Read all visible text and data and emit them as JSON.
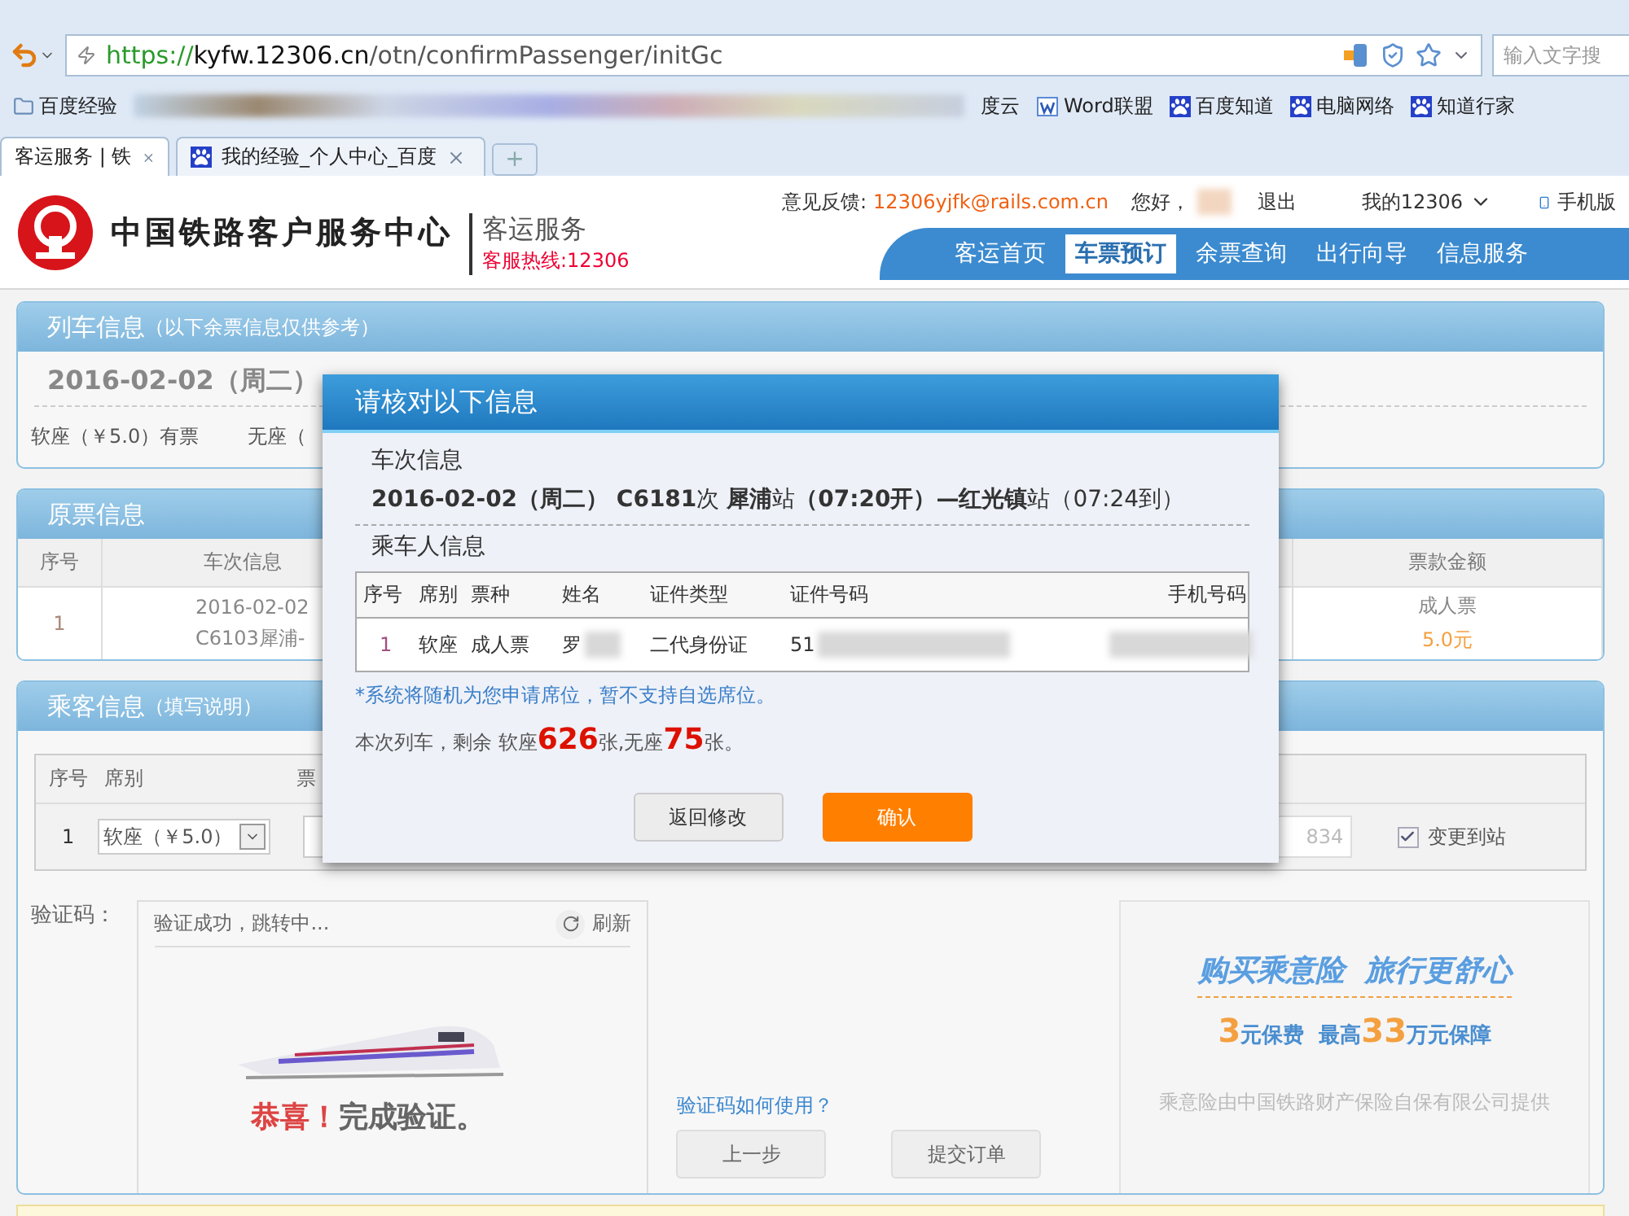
{
  "browser": {
    "address": {
      "scheme": "https://",
      "host": "kyfw.12306.cn",
      "path": "/otn/confirmPassenger/initGc"
    },
    "search": {
      "placeholder": "输入文字搜"
    },
    "bookmarks": [
      {
        "label": "百度经验",
        "kind": "folder"
      },
      {
        "label": "度云",
        "kind": "plain"
      },
      {
        "label": "Word联盟",
        "kind": "doc"
      },
      {
        "label": "百度知道",
        "kind": "paw"
      },
      {
        "label": "电脑网络",
        "kind": "paw"
      },
      {
        "label": "知道行家",
        "kind": "paw"
      }
    ],
    "tabs": [
      {
        "label": "客运服务 | 铁",
        "selected": true,
        "icon": false
      },
      {
        "label": "我的经验_个人中心_百度",
        "selected": false,
        "icon": true
      }
    ],
    "new_tab": "+"
  },
  "header": {
    "site_title": "中国铁路客户服务中心",
    "section": "客运服务",
    "hotline": "客服热线:12306",
    "feedback_label": "意见反馈:",
    "feedback_email": "12306yjfk@rails.com.cn",
    "greeting": "您好，",
    "logout": "退出",
    "account": "我的12306",
    "mobile": "手机版",
    "nav": [
      {
        "label": "客运首页",
        "selected": false
      },
      {
        "label": "车票预订",
        "selected": true
      },
      {
        "label": "余票查询",
        "selected": false
      },
      {
        "label": "出行向导",
        "selected": false
      },
      {
        "label": "信息服务",
        "selected": false
      }
    ]
  },
  "train_info": {
    "title": "列车信息",
    "note": "（以下余票信息仅供参考）",
    "date": "2016-02-02（周二）",
    "seats": [
      "软座（￥5.0）有票",
      "无座（"
    ]
  },
  "original_ticket": {
    "title": "原票信息",
    "columns": [
      "序号",
      "车次信息",
      "票款金额"
    ],
    "row": {
      "index": "1",
      "train_line_1": "2016-02-02",
      "train_line_2": "C6103犀浦-",
      "ticket_type": "成人票",
      "price": "5.0元"
    }
  },
  "passenger_info": {
    "title": "乘客信息",
    "note": "（填写说明）",
    "columns": [
      "序号",
      "席别",
      "票"
    ],
    "row": {
      "index": "1",
      "seat": "软座（￥5.0）",
      "phone_fragment": "834",
      "change_station": {
        "label": "变更到站",
        "checked": true
      }
    }
  },
  "captcha": {
    "label": "验证码：",
    "status": "验证成功，跳转中...",
    "refresh": "刷新",
    "congrats": "恭喜！",
    "done": "完成验证。",
    "help_link": "验证码如何使用？",
    "buttons": [
      "上一步",
      "提交订单"
    ]
  },
  "insurance": {
    "headline": "购买乘意险  旅行更舒心",
    "offer": "**3**元保费  最高**33**万元保障",
    "provider": "乘意险由中国铁路财产保险自保有限公司提供"
  },
  "dialog": {
    "title": "请核对以下信息",
    "train_heading": "车次信息",
    "train_line": "**2016-02-02（周二）  C6181**次 **犀浦**站**（07:20开）—红光镇**站（07:24到）",
    "passenger_heading": "乘车人信息",
    "columns": [
      "序号",
      "席别",
      "票种",
      "姓名",
      "证件类型",
      "证件号码",
      "手机号码"
    ],
    "rows": [
      {
        "index": "1",
        "seat": "软座",
        "ticket": "成人票",
        "name": "罗",
        "id_type": "二代身份证",
        "id_number": "51"
      }
    ],
    "notice": "*系统将随机为您申请席位，暂不支持自选席位。",
    "remaining": "本次列车，剩余 软座**626**张,无座**75**张。",
    "buttons": [
      {
        "label": "返回修改",
        "kind": "secondary"
      },
      {
        "label": "确认",
        "kind": "primary"
      }
    ]
  }
}
